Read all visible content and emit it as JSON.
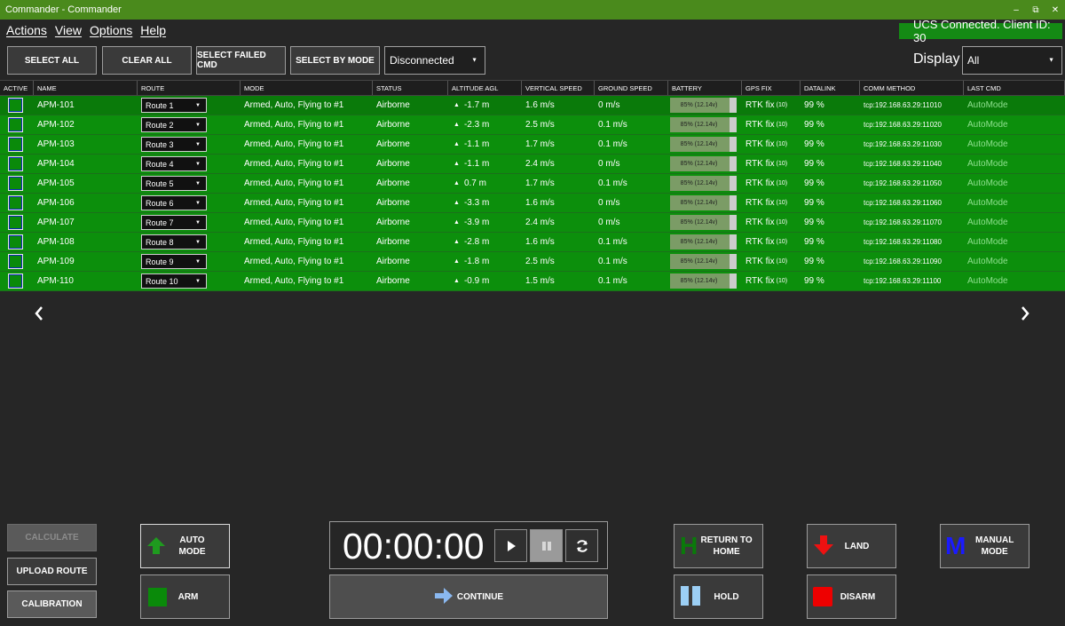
{
  "window": {
    "title": "Commander - Commander",
    "minimize": "–",
    "restore": "⧉",
    "close": "✕"
  },
  "menu": [
    "Actions",
    "View",
    "Options",
    "Help"
  ],
  "connection_status": "UCS Connected. Client ID: 30",
  "toolbar": {
    "select_all": "SELECT ALL",
    "clear_all": "CLEAR ALL",
    "select_failed": "SELECT FAILED CMD",
    "select_by_mode": "SELECT BY MODE",
    "mode_value": "Disconnected",
    "display_label": "Display",
    "display_value": "All"
  },
  "columns": [
    "ACTIVE",
    "NAME",
    "ROUTE",
    "MODE",
    "STATUS",
    "ALTITUDE AGL",
    "VERTICAL SPEED",
    "GROUND SPEED",
    "BATTERY",
    "GPS FIX",
    "DATALINK",
    "COMM METHOD",
    "LAST CMD"
  ],
  "rows": [
    {
      "name": "APM-101",
      "route": "Route 1",
      "mode": "Armed, Auto, Flying to #1",
      "status": "Airborne",
      "alt": "-1.7 m",
      "vs": "1.6 m/s",
      "gs": "0 m/s",
      "battery": "85% (12.14v)",
      "battery_pct": 85,
      "gps": "RTK fix",
      "sats": "(10)",
      "datalink": "99 %",
      "comm": "tcp:192.168.63.29:11010",
      "last": "AutoMode"
    },
    {
      "name": "APM-102",
      "route": "Route 2",
      "mode": "Armed, Auto, Flying to #1",
      "status": "Airborne",
      "alt": "-2.3 m",
      "vs": "2.5 m/s",
      "gs": "0.1 m/s",
      "battery": "85% (12.14v)",
      "battery_pct": 85,
      "gps": "RTK fix",
      "sats": "(10)",
      "datalink": "99 %",
      "comm": "tcp:192.168.63.29:11020",
      "last": "AutoMode"
    },
    {
      "name": "APM-103",
      "route": "Route 3",
      "mode": "Armed, Auto, Flying to #1",
      "status": "Airborne",
      "alt": "-1.1 m",
      "vs": "1.7 m/s",
      "gs": "0.1 m/s",
      "battery": "85% (12.14v)",
      "battery_pct": 85,
      "gps": "RTK fix",
      "sats": "(10)",
      "datalink": "99 %",
      "comm": "tcp:192.168.63.29:11030",
      "last": "AutoMode"
    },
    {
      "name": "APM-104",
      "route": "Route 4",
      "mode": "Armed, Auto, Flying to #1",
      "status": "Airborne",
      "alt": "-1.1 m",
      "vs": "2.4 m/s",
      "gs": "0 m/s",
      "battery": "85% (12.14v)",
      "battery_pct": 85,
      "gps": "RTK fix",
      "sats": "(10)",
      "datalink": "99 %",
      "comm": "tcp:192.168.63.29:11040",
      "last": "AutoMode"
    },
    {
      "name": "APM-105",
      "route": "Route 5",
      "mode": "Armed, Auto, Flying to #1",
      "status": "Airborne",
      "alt": "0.7 m",
      "vs": "1.7 m/s",
      "gs": "0.1 m/s",
      "battery": "85% (12.14v)",
      "battery_pct": 85,
      "gps": "RTK fix",
      "sats": "(10)",
      "datalink": "99 %",
      "comm": "tcp:192.168.63.29:11050",
      "last": "AutoMode"
    },
    {
      "name": "APM-106",
      "route": "Route 6",
      "mode": "Armed, Auto, Flying to #1",
      "status": "Airborne",
      "alt": "-3.3 m",
      "vs": "1.6 m/s",
      "gs": "0 m/s",
      "battery": "85% (12.14v)",
      "battery_pct": 85,
      "gps": "RTK fix",
      "sats": "(10)",
      "datalink": "99 %",
      "comm": "tcp:192.168.63.29:11060",
      "last": "AutoMode"
    },
    {
      "name": "APM-107",
      "route": "Route 7",
      "mode": "Armed, Auto, Flying to #1",
      "status": "Airborne",
      "alt": "-3.9 m",
      "vs": "2.4 m/s",
      "gs": "0 m/s",
      "battery": "85% (12.14v)",
      "battery_pct": 85,
      "gps": "RTK fix",
      "sats": "(10)",
      "datalink": "99 %",
      "comm": "tcp:192.168.63.29:11070",
      "last": "AutoMode"
    },
    {
      "name": "APM-108",
      "route": "Route 8",
      "mode": "Armed, Auto, Flying to #1",
      "status": "Airborne",
      "alt": "-2.8 m",
      "vs": "1.6 m/s",
      "gs": "0.1 m/s",
      "battery": "85% (12.14v)",
      "battery_pct": 85,
      "gps": "RTK fix",
      "sats": "(10)",
      "datalink": "99 %",
      "comm": "tcp:192.168.63.29:11080",
      "last": "AutoMode"
    },
    {
      "name": "APM-109",
      "route": "Route 9",
      "mode": "Armed, Auto, Flying to #1",
      "status": "Airborne",
      "alt": "-1.8 m",
      "vs": "2.5 m/s",
      "gs": "0.1 m/s",
      "battery": "85% (12.14v)",
      "battery_pct": 85,
      "gps": "RTK fix",
      "sats": "(10)",
      "datalink": "99 %",
      "comm": "tcp:192.168.63.29:11090",
      "last": "AutoMode"
    },
    {
      "name": "APM-110",
      "route": "Route 10",
      "mode": "Armed, Auto, Flying to #1",
      "status": "Airborne",
      "alt": "-0.9 m",
      "vs": "1.5 m/s",
      "gs": "0.1 m/s",
      "battery": "85% (12.14v)",
      "battery_pct": 85,
      "gps": "RTK fix",
      "sats": "(10)",
      "datalink": "99 %",
      "comm": "tcp:192.168.63.29:11100",
      "last": "AutoMode"
    }
  ],
  "pager": {
    "prev": "‹",
    "next": "›"
  },
  "controls": {
    "calculate": "CALCULATE",
    "upload_route": "UPLOAD ROUTE",
    "calibration": "CALIBRATION",
    "auto_mode": "AUTO MODE",
    "arm": "ARM",
    "timer": "00:00:00",
    "continue": "CONTINUE",
    "return_home": "RETURN TO HOME",
    "hold": "HOLD",
    "land": "LAND",
    "disarm": "DISARM",
    "manual_mode": "MANUAL MODE",
    "manual_letter": "M",
    "home_letter": "H"
  },
  "colors": {
    "row_green": "#0c8f0c",
    "titlebar": "#4a8a1c",
    "accent_blue": "#1a1aff",
    "red": "#e00000"
  }
}
